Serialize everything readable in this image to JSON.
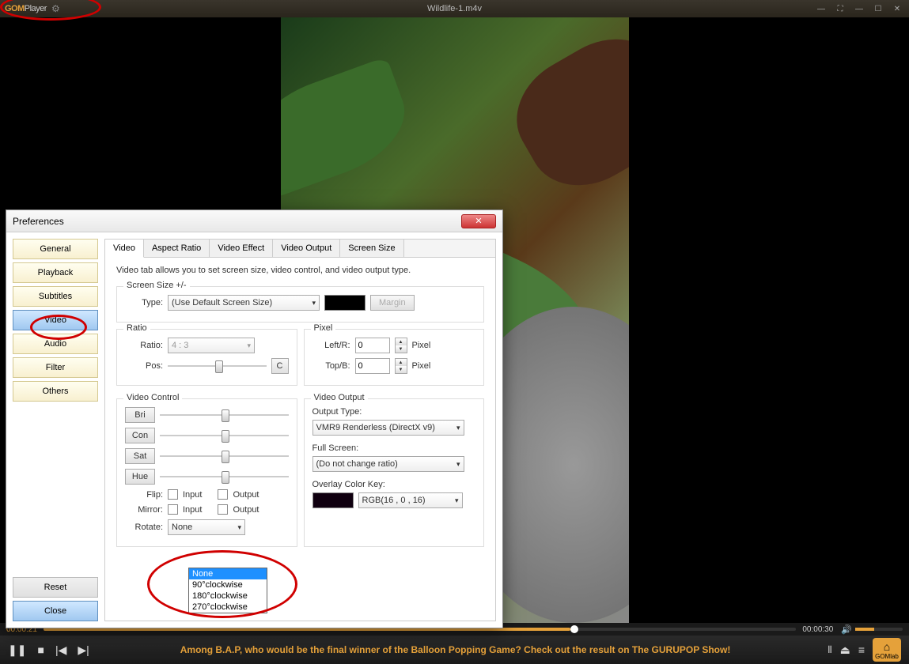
{
  "app": {
    "brand1": "GOM",
    "brand2": "Player",
    "title": "Wildlife-1.m4v"
  },
  "timeline": {
    "elapsed": "00:00:21",
    "total": "00:00:30"
  },
  "marquee": "Among B.A.P, who would be the final winner of the Balloon Popping Game? Check out the result on The GURUPOP Show!",
  "home_label": "GOMlab",
  "prefs": {
    "title": "Preferences",
    "sidebar": [
      "General",
      "Playback",
      "Subtitles",
      "Video",
      "Audio",
      "Filter",
      "Others"
    ],
    "reset": "Reset",
    "close": "Close",
    "tabs": [
      "Video",
      "Aspect Ratio",
      "Video Effect",
      "Video Output",
      "Screen Size"
    ],
    "desc": "Video tab allows you to set screen size, video control, and video output type.",
    "screen": {
      "legend": "Screen Size +/-",
      "type_label": "Type:",
      "type_value": "(Use Default Screen Size)",
      "margin": "Margin"
    },
    "ratio": {
      "legend": "Ratio",
      "ratio_label": "Ratio:",
      "ratio_value": "4 : 3",
      "pos_label": "Pos:",
      "pos_btn": "C"
    },
    "pixel": {
      "legend": "Pixel",
      "lr_label": "Left/R:",
      "lr_value": "0",
      "lr_unit": "Pixel",
      "tb_label": "Top/B:",
      "tb_value": "0",
      "tb_unit": "Pixel"
    },
    "vcontrol": {
      "legend": "Video Control",
      "bri": "Bri",
      "con": "Con",
      "sat": "Sat",
      "hue": "Hue",
      "flip_label": "Flip:",
      "mirror_label": "Mirror:",
      "rotate_label": "Rotate:",
      "input": "Input",
      "output": "Output",
      "rotate_value": "None"
    },
    "voutput": {
      "legend": "Video Output",
      "output_type_label": "Output Type:",
      "output_type_value": "VMR9 Renderless (DirectX v9)",
      "fullscreen_label": "Full Screen:",
      "fullscreen_value": "(Do not change ratio)",
      "overlay_label": "Overlay Color Key:",
      "overlay_value": "RGB(16 , 0 , 16)"
    },
    "rotate_options": [
      "None",
      "90°clockwise",
      "180°clockwise",
      "270°clockwise"
    ]
  }
}
